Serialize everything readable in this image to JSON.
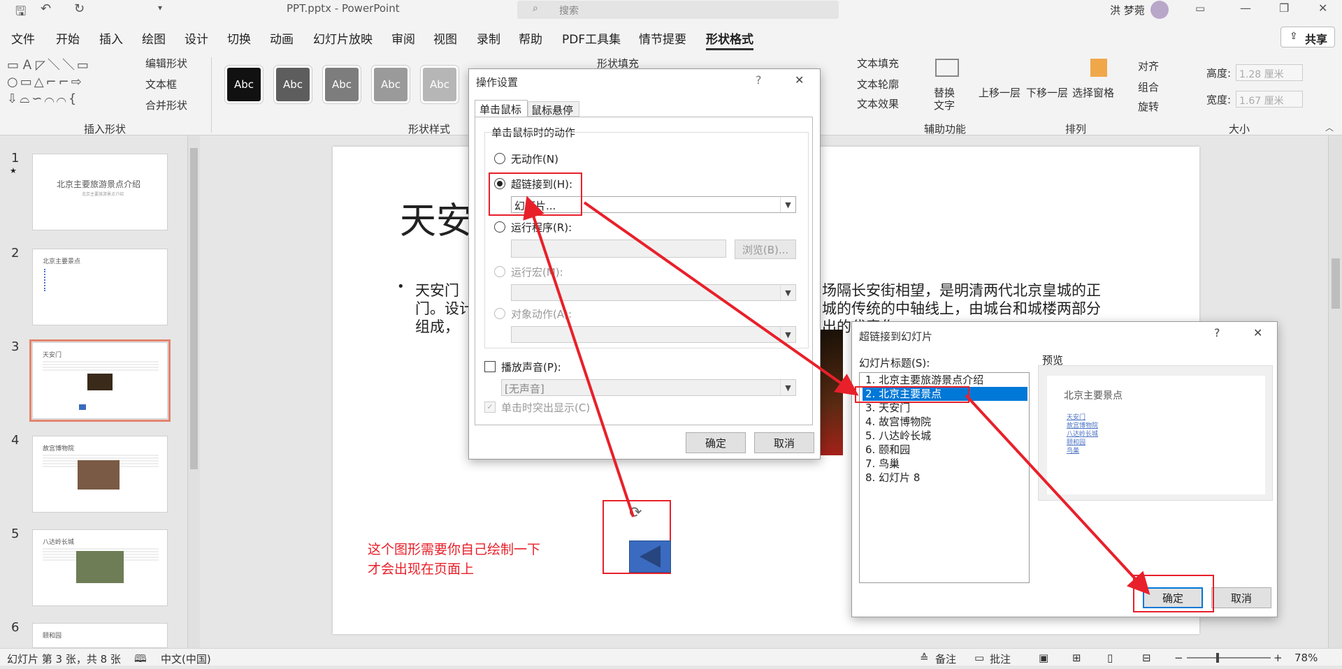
{
  "titlebar": {
    "doc_title": "PPT.pptx  -  PowerPoint",
    "search_placeholder": "搜索",
    "user_name": "洪 梦菀"
  },
  "ribbon_tabs": [
    "文件",
    "开始",
    "插入",
    "绘图",
    "设计",
    "切换",
    "动画",
    "幻灯片放映",
    "审阅",
    "视图",
    "录制",
    "帮助",
    "PDF工具集",
    "情节提要",
    "形状格式"
  ],
  "share_label": "共享",
  "ribbon": {
    "insert_shapes": {
      "edit_shape": "编辑形状",
      "text_box": "文本框",
      "merge_shapes": "合并形状",
      "group_label": "插入形状"
    },
    "shape_styles": {
      "sample": "Abc",
      "shape_fill": "形状填充",
      "group_label": "形状样式"
    },
    "wordart": {
      "text_fill": "文本填充",
      "text_outline": "文本轮廓",
      "text_effects": "文本效果"
    },
    "accessibility": {
      "alt_text": "替换文字",
      "group_label": "辅助功能"
    },
    "arrange": {
      "bring_forward": "上移一层",
      "send_backward": "下移一层",
      "selection_pane": "选择窗格",
      "align": "对齐",
      "group": "组合",
      "rotate": "旋转",
      "group_label": "排列"
    },
    "size": {
      "height_label": "高度:",
      "height_value": "1.28 厘米",
      "width_label": "宽度:",
      "width_value": "1.67 厘米",
      "group_label": "大小"
    }
  },
  "thumbnails": [
    {
      "num": "1",
      "star": "★",
      "title": "北京主要旅游景点介绍",
      "subtitle": "北京主要旅游景点介绍"
    },
    {
      "num": "2",
      "title": "北京主要景点"
    },
    {
      "num": "3",
      "title": "天安门"
    },
    {
      "num": "4",
      "title": "故宫博物院"
    },
    {
      "num": "5",
      "title": "八达岭长城"
    },
    {
      "num": "6",
      "title": "颐和园"
    }
  ],
  "slide": {
    "title": "天安",
    "bullet_line1_left": "天安门",
    "bullet_line1_right": "场隔长安街相望，是明清两代北京皇城的正",
    "bullet_line2_left": "门。设计",
    "bullet_line2_right": "城的传统的中轴线上，由城台和城楼两部分",
    "bullet_line3_left": "组成，",
    "bullet_line3_right": "出的代表作。",
    "annotation_line1": "这个图形需要你自己绘制一下",
    "annotation_line2": "才会出现在页面上"
  },
  "action_dialog": {
    "title": "操作设置",
    "help": "?",
    "close": "✕",
    "tab_click": "单击鼠标",
    "tab_hover": "鼠标悬停",
    "group_label": "单击鼠标时的动作",
    "opt_none": "无动作(N)",
    "opt_hyperlink": "超链接到(H):",
    "hyperlink_value": "幻灯片...",
    "opt_run_program": "运行程序(R):",
    "browse": "浏览(B)...",
    "opt_run_macro": "运行宏(M):",
    "opt_object_action": "对象动作(A):",
    "play_sound": "播放声音(P):",
    "sound_value": "[无声音]",
    "highlight_click": "单击时突出显示(C)",
    "ok": "确定",
    "cancel": "取消"
  },
  "hyperlink_dialog": {
    "title": "超链接到幻灯片",
    "help": "?",
    "close": "✕",
    "list_label": "幻灯片标题(S):",
    "preview_label": "预览",
    "items": [
      "1. 北京主要旅游景点介绍",
      "2. 北京主要景点",
      "3. 天安门",
      "4. 故宫博物院",
      "5. 八达岭长城",
      "6. 颐和园",
      "7. 鸟巢",
      "8. 幻灯片 8"
    ],
    "selected_index": 1,
    "preview_title": "北京主要景点",
    "preview_links": [
      "天安门",
      "故宫博物院",
      "八达岭长城",
      "颐和园",
      "鸟巢"
    ],
    "ok": "确定",
    "cancel": "取消"
  },
  "statusbar": {
    "slide_info": "幻灯片 第 3 张，共 8 张",
    "language": "中文(中国)",
    "notes": "备注",
    "comments": "批注",
    "zoom": "78%"
  },
  "colors": {
    "accent_red": "#e8202a",
    "selection_blue": "#0078d7",
    "shape_blue": "#3a6bc0"
  }
}
